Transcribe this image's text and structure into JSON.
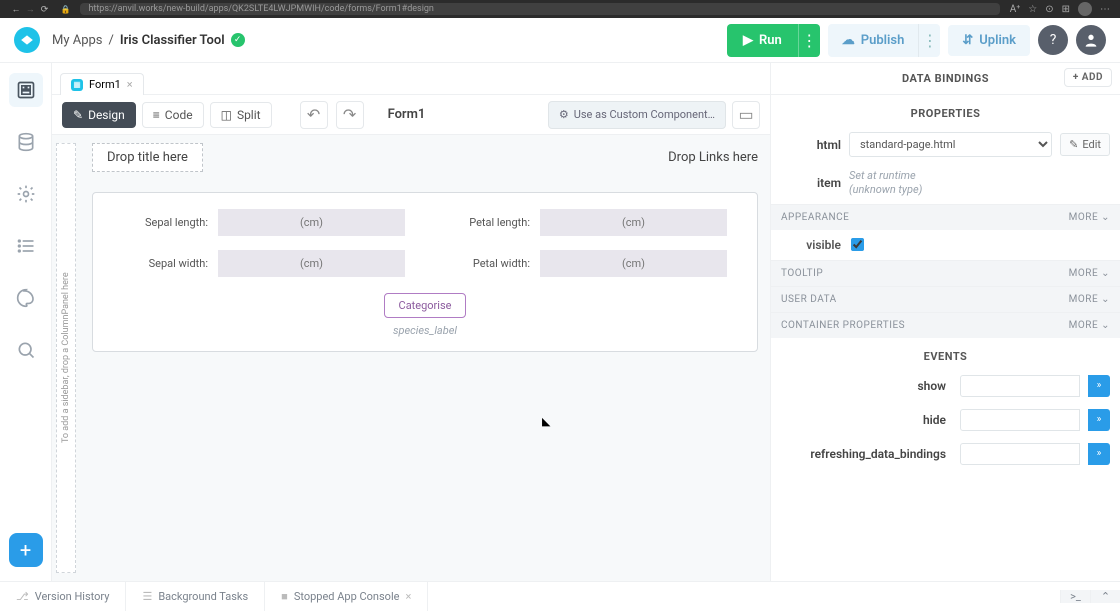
{
  "browser": {
    "url": "https://anvil.works/new-build/apps/QK2SLTE4LWJPMWIH/code/forms/Form1#design"
  },
  "header": {
    "my_apps": "My Apps",
    "sep": "/",
    "app_name": "Iris Classifier Tool",
    "run": "Run",
    "publish": "Publish",
    "uplink": "Uplink"
  },
  "tabs": {
    "file": "Form1"
  },
  "toolbar": {
    "design": "Design",
    "code": "Code",
    "split": "Split",
    "form_name": "Form1",
    "custom": "Use as Custom Component…"
  },
  "canvas": {
    "sidebar_hint": "To add a sidebar, drop a ColumnPanel here",
    "title_drop": "Drop title here",
    "links_drop": "Drop Links here",
    "fields": {
      "sepal_length_label": "Sepal length:",
      "sepal_width_label": "Sepal width:",
      "petal_length_label": "Petal length:",
      "petal_width_label": "Petal width:",
      "placeholder": "(cm)"
    },
    "categorise": "Categorise",
    "species": "species_label"
  },
  "props": {
    "data_bindings": "DATA BINDINGS",
    "add": "ADD",
    "properties": "PROPERTIES",
    "html_label": "html",
    "html_value": "standard-page.html",
    "edit": "Edit",
    "item_label": "item",
    "item_desc1": "Set at runtime",
    "item_desc2": "(unknown type)",
    "appearance": "APPEARANCE",
    "visible": "visible",
    "tooltip": "TOOLTIP",
    "user_data": "USER DATA",
    "container": "CONTAINER PROPERTIES",
    "more": "MORE ⌄",
    "events": "EVENTS",
    "ev_show": "show",
    "ev_hide": "hide",
    "ev_refresh": "refreshing_data_bindings"
  },
  "bottom": {
    "version": "Version History",
    "bg": "Background Tasks",
    "console": "Stopped App Console"
  }
}
